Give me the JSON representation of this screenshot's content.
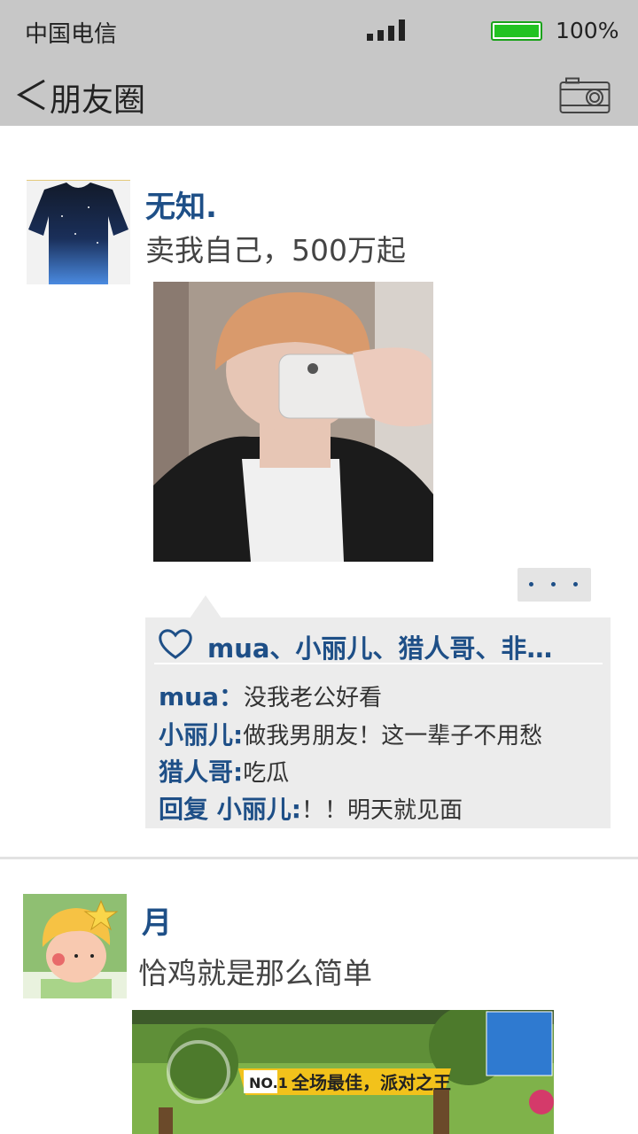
{
  "status_bar": {
    "carrier": "中国电信",
    "battery_percent": "100%",
    "battery_color": "#22c322"
  },
  "nav": {
    "back_icon": "chevron-left-icon",
    "title": "朋友圈",
    "camera_icon": "camera-icon"
  },
  "posts": [
    {
      "name": "无知.",
      "text": "卖我自己，500万起",
      "likes": "mua、小丽儿、猎人哥、非…",
      "comments": [
        {
          "who": "mua：",
          "text": "没我老公好看"
        },
        {
          "who": "小丽儿:",
          "text": "做我男朋友！这一辈子不用愁"
        },
        {
          "who": "猎人哥:",
          "text": "吃瓜"
        },
        {
          "who": "回复 小丽儿:",
          "text": "！！明天就见面"
        }
      ]
    },
    {
      "name": "月",
      "text": "恰鸡就是那么简单",
      "game_banner": "全场最佳，派对之王"
    }
  ],
  "colors": {
    "bar_bg": "#c7c7c7",
    "name_blue": "#1e4f87",
    "comment_bg": "#ececec"
  }
}
